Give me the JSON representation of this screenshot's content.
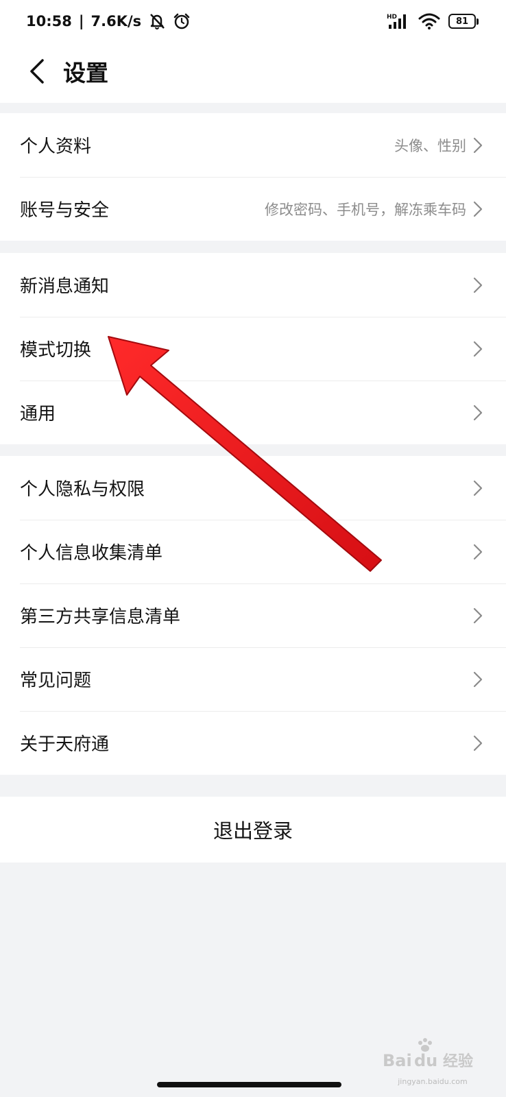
{
  "status_bar": {
    "time": "10:58",
    "separator": "|",
    "speed": "7.6K/s",
    "icons": [
      "mute-bell-icon",
      "alarm-icon",
      "hd-signal-icon",
      "wifi-icon",
      "battery-icon"
    ],
    "battery": "81"
  },
  "header": {
    "title": "设置"
  },
  "groups": [
    {
      "items": [
        {
          "label": "个人资料",
          "subtitle": "头像、性别"
        },
        {
          "label": "账号与安全",
          "subtitle": "修改密码、手机号，解冻乘车码"
        }
      ]
    },
    {
      "items": [
        {
          "label": "新消息通知"
        },
        {
          "label": "模式切换"
        },
        {
          "label": "通用"
        }
      ]
    },
    {
      "items": [
        {
          "label": "个人隐私与权限"
        },
        {
          "label": "个人信息收集清单"
        },
        {
          "label": "第三方共享信息清单"
        },
        {
          "label": "常见问题"
        },
        {
          "label": "关于天府通"
        }
      ]
    }
  ],
  "logout": {
    "label": "退出登录"
  },
  "watermark": {
    "brand": "Bai du 经验",
    "url": "jingyan.baidu.com"
  },
  "colors": {
    "background": "#f2f3f5",
    "card": "#ffffff",
    "text": "#141414",
    "subtext": "#8c8c8c",
    "annotation_arrow": "#e8151b"
  }
}
